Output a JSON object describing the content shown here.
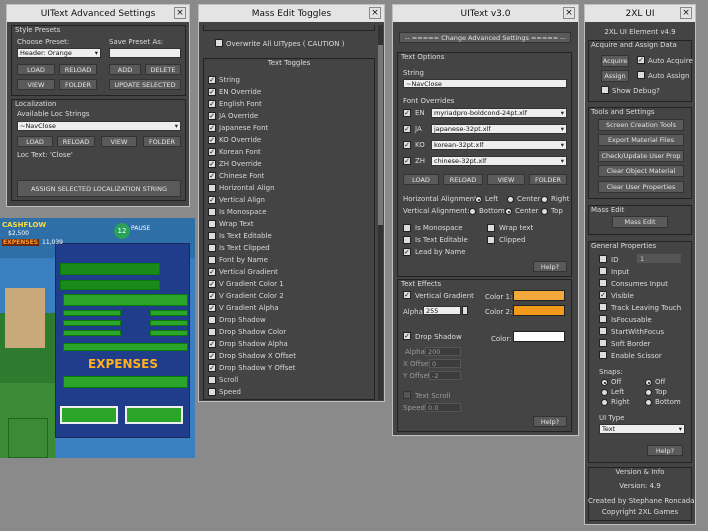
{
  "win1": {
    "title": "UIText Advanced Settings",
    "group": "Style Presets",
    "choose": "Choose Preset:",
    "save_as": "Save Preset As:",
    "preset": "Header: Orange",
    "load": "LOAD",
    "reload": "RELOAD",
    "add": "ADD",
    "delete": "DELETE",
    "view": "VIEW",
    "folder": "FOLDER",
    "update": "UPDATE SELECTED",
    "loc_group": "Localization",
    "available": "Available Loc Strings",
    "loc_value": "~NavClose",
    "loc_load": "LOAD",
    "loc_reload": "RELOAD",
    "loc_view": "VIEW",
    "loc_folder": "FOLDER",
    "loc_text": "Loc Text: 'Close'",
    "assign": "ASSIGN SELECTED LOCALIZATION STRING"
  },
  "game": {
    "cashflow": "CASHFLOW",
    "cash_val": "$2,500",
    "expenses_top": "EXPENSES",
    "exp_val": "11,039",
    "badge": "12",
    "pause": "PAUSE",
    "expenses": "EXPENSES"
  },
  "win2": {
    "title": "Mass Edit Toggles",
    "overwrite": "Overwrite All UITypes ( CAUTION )",
    "group": "Text Toggles",
    "items": [
      {
        "label": "String",
        "checked": true
      },
      {
        "label": "EN Override",
        "checked": true
      },
      {
        "label": "English Font",
        "checked": true
      },
      {
        "label": "JA Override",
        "checked": true
      },
      {
        "label": "Japanese Font",
        "checked": true
      },
      {
        "label": "KO Override",
        "checked": true
      },
      {
        "label": "Korean Font",
        "checked": true
      },
      {
        "label": "ZH Override",
        "checked": true
      },
      {
        "label": "Chinese Font",
        "checked": true
      },
      {
        "label": "Horizontal Align",
        "checked": false
      },
      {
        "label": "Vertical Align",
        "checked": true
      },
      {
        "label": "Is Monospace",
        "checked": false
      },
      {
        "label": "Wrap Text",
        "checked": false
      },
      {
        "label": "Is Text Editable",
        "checked": false
      },
      {
        "label": "Is Text Clipped",
        "checked": false
      },
      {
        "label": "Font by Name",
        "checked": false
      },
      {
        "label": "Vertical Gradient",
        "checked": true
      },
      {
        "label": "V Gradient Color 1",
        "checked": true
      },
      {
        "label": "V Gradient Color 2",
        "checked": true
      },
      {
        "label": "V Gradient Alpha",
        "checked": true
      },
      {
        "label": "Drop Shadow",
        "checked": false
      },
      {
        "label": "Drop Shadow Color",
        "checked": false
      },
      {
        "label": "Drop Shadow Alpha",
        "checked": true
      },
      {
        "label": "Drop Shadow X Offset",
        "checked": true
      },
      {
        "label": "Drop Shadow Y Offset",
        "checked": true
      },
      {
        "label": "Scroll",
        "checked": false
      },
      {
        "label": "Speed",
        "checked": false
      }
    ]
  },
  "win3": {
    "title": "UIText v3.0",
    "adv": "-- ===== Change Advanced Settings ===== --",
    "text_options": "Text Options",
    "string_label": "String",
    "string_value": "~NavClose",
    "font_overrides": "Font Overrides",
    "fonts": [
      {
        "lang": "EN",
        "value": "myriadpro-boldcond-24pt.xlf"
      },
      {
        "lang": "JA",
        "value": "japanese-32pt.xlf"
      },
      {
        "lang": "KO",
        "value": "korean-32pt.xlf"
      },
      {
        "lang": "ZH",
        "value": "chinese-32pt.xlf"
      }
    ],
    "load": "LOAD",
    "reload": "RELOAD",
    "view": "VIEW",
    "folder": "FOLDER",
    "halign": "Horizontal Alignment:",
    "valign": "Vertical Alignment:",
    "left": "Left",
    "center": "Center",
    "right": "Right",
    "bottom": "Bottom",
    "center2": "Center",
    "top": "Top",
    "is_mono": "Is Monospace",
    "wrap": "Wrap text",
    "editable": "Is Text Editable",
    "clipped": "Clipped",
    "lead": "Lead by Name",
    "help": "Help?",
    "effects": "Text Effects",
    "vgrad": "Vertical Gradient",
    "color1": "Color 1:",
    "color2": "Color 2:",
    "alpha": "Alpha:",
    "alpha_val": "255",
    "drop": "Drop Shadow",
    "color": "Color:",
    "alpha2": "Alpha:",
    "alpha2_val": "200",
    "xoff": "X Offset:",
    "xoff_val": "0",
    "yoff": "Y Offset:",
    "yoff_val": "-2",
    "scroll": "Text Scroll",
    "speed": "Speed:",
    "speed_val": "0.0",
    "help2": "Help?",
    "c1": "#f4a93c",
    "c2": "#f39a1c",
    "c3": "#ffffff"
  },
  "win4": {
    "title": "2XL UI",
    "sub": "2XL UI Element v4.9",
    "acq": "Acquire and Assign Data",
    "acquire": "Acquire",
    "auto_acq": "Auto Acquire",
    "assign": "Assign",
    "auto_assign": "Auto Assign",
    "debug": "Show Debug?",
    "tools": "Tools and Settings",
    "t1": "Screen Creation Tools",
    "t2": "Export Material Files",
    "t3": "Check/Update User Prop",
    "t4": "Clear Object Material",
    "t5": "Clear User Properties",
    "mass": "Mass Edit",
    "mass_btn": "Mass Edit",
    "gen": "General Properties",
    "id": "ID",
    "id_val": "1",
    "input": "Input",
    "consumes": "Consumes Input",
    "visible": "Visible",
    "track": "Track Leaving Touch",
    "focusable": "IsFocusable",
    "startfocus": "StartWithFocus",
    "soft": "Soft Border",
    "scissor": "Enable Scissor",
    "snaps": "Snaps:",
    "off": "Off",
    "left": "Left",
    "right": "Right",
    "top": "Top",
    "bottom": "Bottom",
    "uitype": "UI Type",
    "uitype_val": "Text",
    "help": "Help?",
    "ver": "Version & Info",
    "version": "Version: 4.9",
    "created": "Created by Stephane Roncada",
    "copy": "Copyright 2XL Games"
  }
}
